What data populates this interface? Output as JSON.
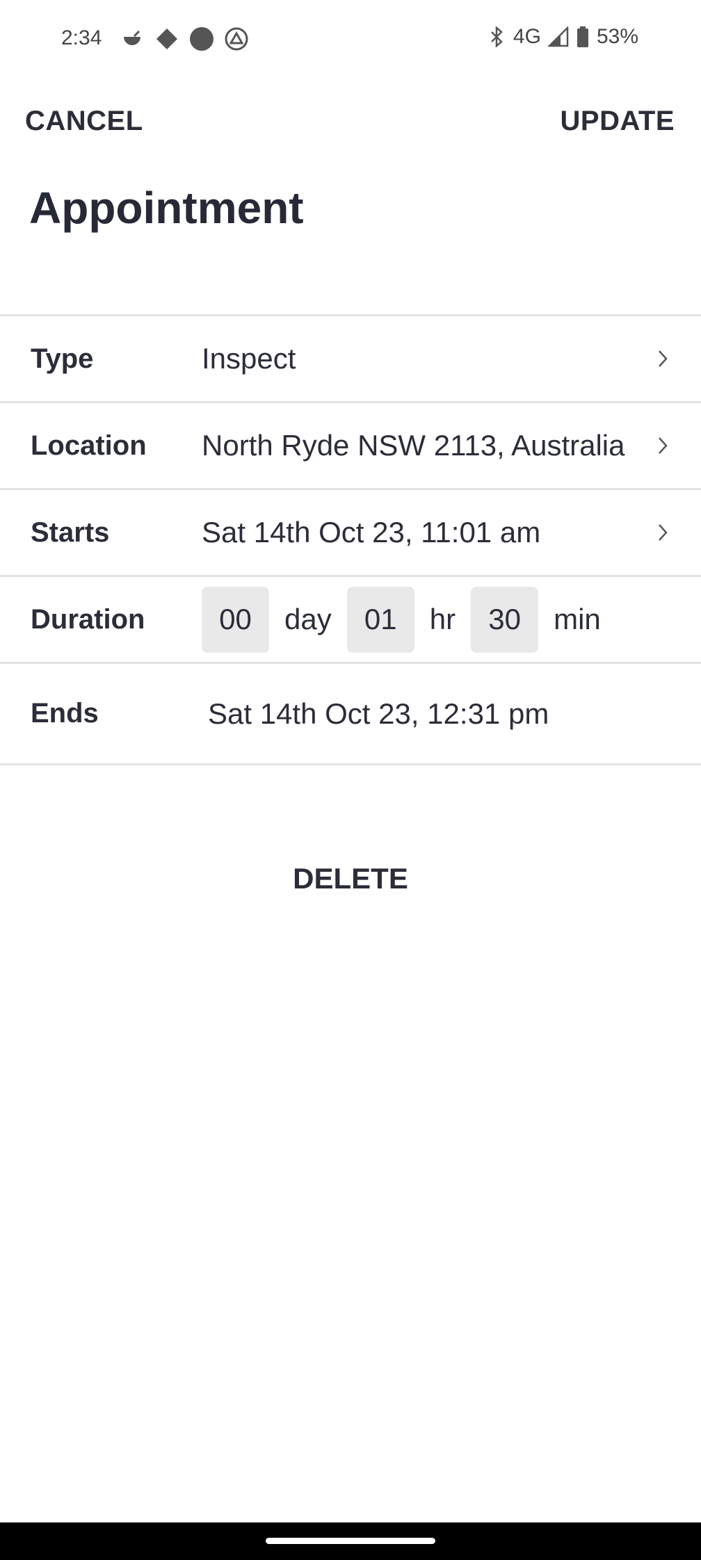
{
  "status_bar": {
    "time": "2:34",
    "network": "4G",
    "battery": "53%",
    "icons": [
      "bowl-icon",
      "diamond-icon",
      "circle-icon",
      "triangle-icon",
      "bluetooth-icon",
      "signal-icon",
      "battery-icon"
    ]
  },
  "header": {
    "cancel_label": "CANCEL",
    "update_label": "UPDATE",
    "title": "Appointment"
  },
  "form": {
    "type": {
      "label": "Type",
      "value": "Inspect"
    },
    "location": {
      "label": "Location",
      "value": "North Ryde NSW 2113, Australia"
    },
    "starts": {
      "label": "Starts",
      "value": "Sat 14th Oct 23, 11:01 am"
    },
    "duration": {
      "label": "Duration",
      "days": "00",
      "day_unit": "day",
      "hours": "01",
      "hour_unit": "hr",
      "minutes": "30",
      "minute_unit": "min"
    },
    "ends": {
      "label": "Ends",
      "value": "Sat 14th Oct 23, 12:31 pm"
    }
  },
  "actions": {
    "delete_label": "DELETE"
  },
  "colors": {
    "text": "#2b2d38",
    "divider": "#e3e3e6",
    "field_bg": "#e9e9e9",
    "nav_bar": "#000000"
  }
}
